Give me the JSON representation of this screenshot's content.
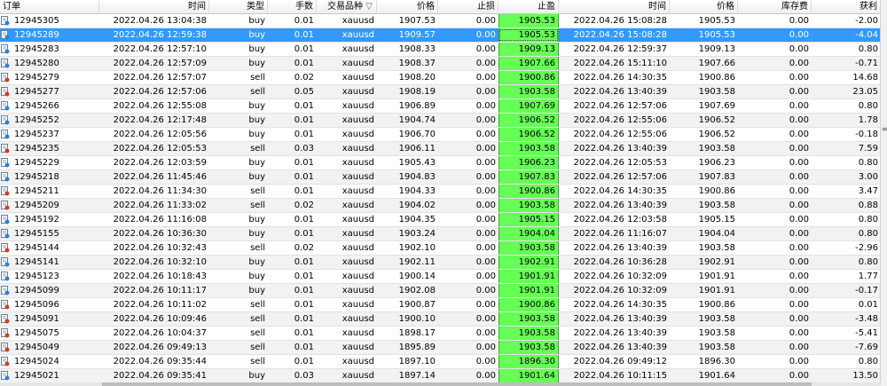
{
  "columns": {
    "order": "订单",
    "open_time": "时间",
    "type": "类型",
    "lots": "手数",
    "symbol": "交易品种",
    "sort_marker": "▽",
    "open_price": "价格",
    "sl": "止损",
    "tp": "止盈",
    "close_time": "时间",
    "close_price": "价格",
    "swap": "库存费",
    "profit": "获利"
  },
  "selected_row_index": 1,
  "rows": [
    {
      "order": "12945305",
      "open_time": "2022.04.26 13:04:38",
      "type": "buy",
      "lots": "0.01",
      "symbol": "xauusd",
      "open_price": "1907.53",
      "sl": "0.00",
      "tp": "1905.53",
      "close_time": "2022.04.26 15:08:28",
      "close_price": "1905.53",
      "swap": "0.00",
      "profit": "-2.00"
    },
    {
      "order": "12945289",
      "open_time": "2022.04.26 12:59:38",
      "type": "buy",
      "lots": "0.01",
      "symbol": "xauusd",
      "open_price": "1909.57",
      "sl": "0.00",
      "tp": "1905.53",
      "close_time": "2022.04.26 15:08:28",
      "close_price": "1905.53",
      "swap": "0.00",
      "profit": "-4.04"
    },
    {
      "order": "12945283",
      "open_time": "2022.04.26 12:57:10",
      "type": "buy",
      "lots": "0.01",
      "symbol": "xauusd",
      "open_price": "1908.33",
      "sl": "0.00",
      "tp": "1909.13",
      "close_time": "2022.04.26 12:59:37",
      "close_price": "1909.13",
      "swap": "0.00",
      "profit": "0.80"
    },
    {
      "order": "12945280",
      "open_time": "2022.04.26 12:57:09",
      "type": "buy",
      "lots": "0.01",
      "symbol": "xauusd",
      "open_price": "1908.37",
      "sl": "0.00",
      "tp": "1907.66",
      "close_time": "2022.04.26 15:11:10",
      "close_price": "1907.66",
      "swap": "0.00",
      "profit": "-0.71"
    },
    {
      "order": "12945279",
      "open_time": "2022.04.26 12:57:07",
      "type": "sell",
      "lots": "0.02",
      "symbol": "xauusd",
      "open_price": "1908.20",
      "sl": "0.00",
      "tp": "1900.86",
      "close_time": "2022.04.26 14:30:35",
      "close_price": "1900.86",
      "swap": "0.00",
      "profit": "14.68"
    },
    {
      "order": "12945277",
      "open_time": "2022.04.26 12:57:06",
      "type": "sell",
      "lots": "0.05",
      "symbol": "xauusd",
      "open_price": "1908.19",
      "sl": "0.00",
      "tp": "1903.58",
      "close_time": "2022.04.26 13:40:39",
      "close_price": "1903.58",
      "swap": "0.00",
      "profit": "23.05"
    },
    {
      "order": "12945266",
      "open_time": "2022.04.26 12:55:08",
      "type": "buy",
      "lots": "0.01",
      "symbol": "xauusd",
      "open_price": "1906.89",
      "sl": "0.00",
      "tp": "1907.69",
      "close_time": "2022.04.26 12:57:06",
      "close_price": "1907.69",
      "swap": "0.00",
      "profit": "0.80"
    },
    {
      "order": "12945252",
      "open_time": "2022.04.26 12:17:48",
      "type": "buy",
      "lots": "0.01",
      "symbol": "xauusd",
      "open_price": "1904.74",
      "sl": "0.00",
      "tp": "1906.52",
      "close_time": "2022.04.26 12:55:06",
      "close_price": "1906.52",
      "swap": "0.00",
      "profit": "1.78"
    },
    {
      "order": "12945237",
      "open_time": "2022.04.26 12:05:56",
      "type": "buy",
      "lots": "0.01",
      "symbol": "xauusd",
      "open_price": "1906.70",
      "sl": "0.00",
      "tp": "1906.52",
      "close_time": "2022.04.26 12:55:06",
      "close_price": "1906.52",
      "swap": "0.00",
      "profit": "-0.18"
    },
    {
      "order": "12945235",
      "open_time": "2022.04.26 12:05:53",
      "type": "sell",
      "lots": "0.03",
      "symbol": "xauusd",
      "open_price": "1906.11",
      "sl": "0.00",
      "tp": "1903.58",
      "close_time": "2022.04.26 13:40:39",
      "close_price": "1903.58",
      "swap": "0.00",
      "profit": "7.59"
    },
    {
      "order": "12945229",
      "open_time": "2022.04.26 12:03:59",
      "type": "buy",
      "lots": "0.01",
      "symbol": "xauusd",
      "open_price": "1905.43",
      "sl": "0.00",
      "tp": "1906.23",
      "close_time": "2022.04.26 12:05:53",
      "close_price": "1906.23",
      "swap": "0.00",
      "profit": "0.80"
    },
    {
      "order": "12945218",
      "open_time": "2022.04.26 11:45:46",
      "type": "buy",
      "lots": "0.01",
      "symbol": "xauusd",
      "open_price": "1904.83",
      "sl": "0.00",
      "tp": "1907.83",
      "close_time": "2022.04.26 12:57:06",
      "close_price": "1907.83",
      "swap": "0.00",
      "profit": "3.00"
    },
    {
      "order": "12945211",
      "open_time": "2022.04.26 11:34:30",
      "type": "sell",
      "lots": "0.01",
      "symbol": "xauusd",
      "open_price": "1904.33",
      "sl": "0.00",
      "tp": "1900.86",
      "close_time": "2022.04.26 14:30:35",
      "close_price": "1900.86",
      "swap": "0.00",
      "profit": "3.47"
    },
    {
      "order": "12945209",
      "open_time": "2022.04.26 11:33:02",
      "type": "sell",
      "lots": "0.02",
      "symbol": "xauusd",
      "open_price": "1904.02",
      "sl": "0.00",
      "tp": "1903.58",
      "close_time": "2022.04.26 13:40:39",
      "close_price": "1903.58",
      "swap": "0.00",
      "profit": "0.88"
    },
    {
      "order": "12945192",
      "open_time": "2022.04.26 11:16:08",
      "type": "buy",
      "lots": "0.01",
      "symbol": "xauusd",
      "open_price": "1904.35",
      "sl": "0.00",
      "tp": "1905.15",
      "close_time": "2022.04.26 12:03:58",
      "close_price": "1905.15",
      "swap": "0.00",
      "profit": "0.80"
    },
    {
      "order": "12945155",
      "open_time": "2022.04.26 10:36:30",
      "type": "buy",
      "lots": "0.01",
      "symbol": "xauusd",
      "open_price": "1903.24",
      "sl": "0.00",
      "tp": "1904.04",
      "close_time": "2022.04.26 11:16:07",
      "close_price": "1904.04",
      "swap": "0.00",
      "profit": "0.80"
    },
    {
      "order": "12945144",
      "open_time": "2022.04.26 10:32:43",
      "type": "sell",
      "lots": "0.02",
      "symbol": "xauusd",
      "open_price": "1902.10",
      "sl": "0.00",
      "tp": "1903.58",
      "close_time": "2022.04.26 13:40:39",
      "close_price": "1903.58",
      "swap": "0.00",
      "profit": "-2.96"
    },
    {
      "order": "12945141",
      "open_time": "2022.04.26 10:32:10",
      "type": "buy",
      "lots": "0.01",
      "symbol": "xauusd",
      "open_price": "1902.11",
      "sl": "0.00",
      "tp": "1902.91",
      "close_time": "2022.04.26 10:36:28",
      "close_price": "1902.91",
      "swap": "0.00",
      "profit": "0.80"
    },
    {
      "order": "12945123",
      "open_time": "2022.04.26 10:18:43",
      "type": "buy",
      "lots": "0.01",
      "symbol": "xauusd",
      "open_price": "1900.14",
      "sl": "0.00",
      "tp": "1901.91",
      "close_time": "2022.04.26 10:32:09",
      "close_price": "1901.91",
      "swap": "0.00",
      "profit": "1.77"
    },
    {
      "order": "12945099",
      "open_time": "2022.04.26 10:11:17",
      "type": "buy",
      "lots": "0.01",
      "symbol": "xauusd",
      "open_price": "1902.08",
      "sl": "0.00",
      "tp": "1901.91",
      "close_time": "2022.04.26 10:32:09",
      "close_price": "1901.91",
      "swap": "0.00",
      "profit": "-0.17"
    },
    {
      "order": "12945096",
      "open_time": "2022.04.26 10:11:02",
      "type": "sell",
      "lots": "0.01",
      "symbol": "xauusd",
      "open_price": "1900.87",
      "sl": "0.00",
      "tp": "1900.86",
      "close_time": "2022.04.26 14:30:35",
      "close_price": "1900.86",
      "swap": "0.00",
      "profit": "0.01"
    },
    {
      "order": "12945091",
      "open_time": "2022.04.26 10:09:46",
      "type": "sell",
      "lots": "0.01",
      "symbol": "xauusd",
      "open_price": "1900.10",
      "sl": "0.00",
      "tp": "1903.58",
      "close_time": "2022.04.26 13:40:39",
      "close_price": "1903.58",
      "swap": "0.00",
      "profit": "-3.48"
    },
    {
      "order": "12945075",
      "open_time": "2022.04.26 10:04:37",
      "type": "sell",
      "lots": "0.01",
      "symbol": "xauusd",
      "open_price": "1898.17",
      "sl": "0.00",
      "tp": "1903.58",
      "close_time": "2022.04.26 13:40:39",
      "close_price": "1903.58",
      "swap": "0.00",
      "profit": "-5.41"
    },
    {
      "order": "12945049",
      "open_time": "2022.04.26 09:49:13",
      "type": "sell",
      "lots": "0.01",
      "symbol": "xauusd",
      "open_price": "1895.89",
      "sl": "0.00",
      "tp": "1903.58",
      "close_time": "2022.04.26 13:40:39",
      "close_price": "1903.58",
      "swap": "0.00",
      "profit": "-7.69"
    },
    {
      "order": "12945024",
      "open_time": "2022.04.26 09:35:44",
      "type": "sell",
      "lots": "0.01",
      "symbol": "xauusd",
      "open_price": "1897.10",
      "sl": "0.00",
      "tp": "1896.30",
      "close_time": "2022.04.26 09:49:12",
      "close_price": "1896.30",
      "swap": "0.00",
      "profit": "0.80"
    },
    {
      "order": "12945021",
      "open_time": "2022.04.26 09:35:41",
      "type": "buy",
      "lots": "0.03",
      "symbol": "xauusd",
      "open_price": "1897.14",
      "sl": "0.00",
      "tp": "1901.64",
      "close_time": "2022.04.26 10:11:15",
      "close_price": "1901.64",
      "swap": "0.00",
      "profit": "13.50"
    }
  ]
}
